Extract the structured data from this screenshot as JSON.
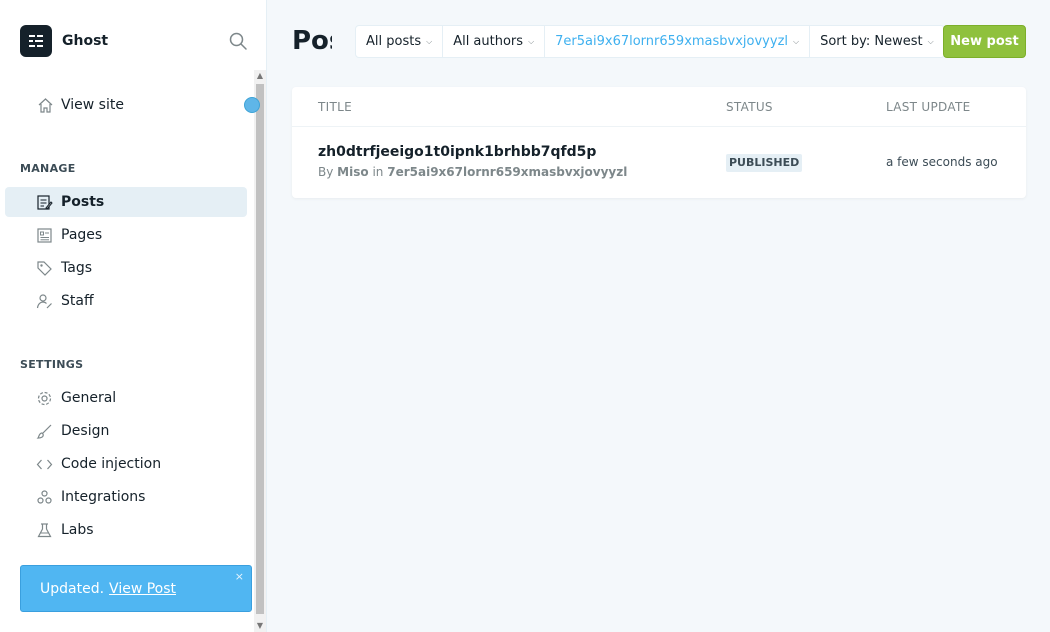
{
  "brand": {
    "name": "Ghost"
  },
  "sidebar": {
    "view_site": "View site",
    "manage_title": "MANAGE",
    "manage_items": [
      {
        "label": "Posts",
        "icon": "posts-icon"
      },
      {
        "label": "Pages",
        "icon": "pages-icon"
      },
      {
        "label": "Tags",
        "icon": "tags-icon"
      },
      {
        "label": "Staff",
        "icon": "staff-icon"
      }
    ],
    "settings_title": "SETTINGS",
    "settings_items": [
      {
        "label": "General",
        "icon": "gear-icon"
      },
      {
        "label": "Design",
        "icon": "brush-icon"
      },
      {
        "label": "Code injection",
        "icon": "code-icon"
      },
      {
        "label": "Integrations",
        "icon": "integrations-icon"
      },
      {
        "label": "Labs",
        "icon": "flask-icon"
      }
    ]
  },
  "toast": {
    "message": "Updated.",
    "link": "View Post",
    "close": "×"
  },
  "header": {
    "title": "Posts",
    "filters": {
      "type": "All posts",
      "author": "All authors",
      "tag": "7er5ai9x67lornr659xmasbvxjovyyzl",
      "sort": "Sort by: Newest"
    },
    "new_post": "New post"
  },
  "table": {
    "columns": {
      "title": "TITLE",
      "status": "STATUS",
      "last_update": "LAST UPDATE"
    },
    "rows": [
      {
        "title": "zh0dtrfjeeigo1t0ipnk1brhbb7qfd5p",
        "by": "By",
        "author": "Miso",
        "in": "in",
        "tag": "7er5ai9x67lornr659xmasbvxjovyyzl",
        "status": "PUBLISHED",
        "last_update": "a few seconds ago"
      }
    ]
  },
  "colors": {
    "accent": "#3eb0ef",
    "primary_button": "#8fc13d",
    "toast": "#50b6f2"
  }
}
